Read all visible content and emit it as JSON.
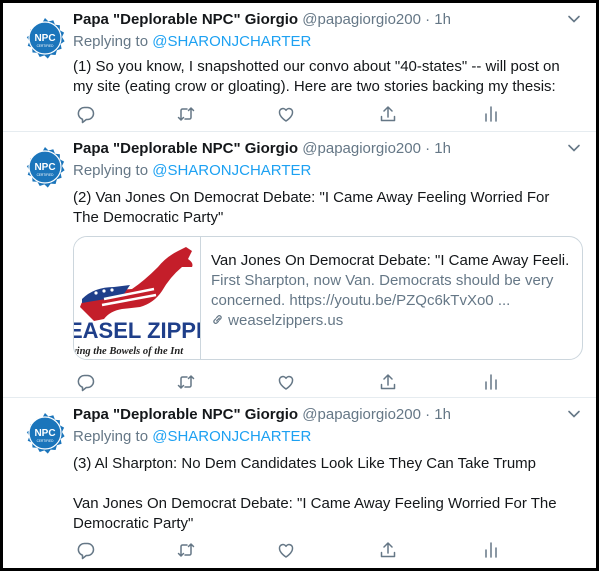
{
  "tweets": [
    {
      "name": "Papa \"Deplorable NPC\" Giorgio",
      "handle": "@papagiorgio200",
      "separator": "·",
      "time": "1h",
      "replying_prefix": "Replying to",
      "replying_to": "@SHARONJCHARTER",
      "paragraphs": [
        "(1) So you know, I snapshotted our convo about \"40-states\" -- will post on my site (eating crow or gloating). Here are two stories backing my thesis:"
      ]
    },
    {
      "name": "Papa \"Deplorable NPC\" Giorgio",
      "handle": "@papagiorgio200",
      "separator": "·",
      "time": "1h",
      "replying_prefix": "Replying to",
      "replying_to": "@SHARONJCHARTER",
      "paragraphs": [
        "(2) Van Jones On Democrat Debate: \"I Came Away Feeling Worried For The Democratic Party\""
      ],
      "card": {
        "title": "Van Jones On Democrat Debate: \"I Came Away Feeli...",
        "description": "First Sharpton, now Van. Democrats should be very concerned. https://youtu.be/PZQc6kTvXo0 ...",
        "domain": "weaselzippers.us",
        "image_text_line1": "EASEL ZIPPE",
        "image_text_line2": "ving the Bowels of the Int"
      }
    },
    {
      "name": "Papa \"Deplorable NPC\" Giorgio",
      "handle": "@papagiorgio200",
      "separator": "·",
      "time": "1h",
      "replying_prefix": "Replying to",
      "replying_to": "@SHARONJCHARTER",
      "paragraphs": [
        "(3) Al Sharpton: No Dem Candidates Look Like They Can Take Trump",
        "Van Jones On Democrat Debate: \"I Came Away Feeling Worried For The Democratic Party\""
      ]
    }
  ],
  "avatar": {
    "text_main": "NPC",
    "text_small": "CERTIFIED",
    "color": "#1b75bb"
  },
  "colors": {
    "link": "#1da1f2",
    "secondary": "#657786",
    "text": "#14171a",
    "border": "#e6ecf0"
  },
  "icons": [
    "reply-icon",
    "retweet-icon",
    "like-icon",
    "share-icon",
    "analytics-icon",
    "chevron-down-icon",
    "link-icon"
  ]
}
